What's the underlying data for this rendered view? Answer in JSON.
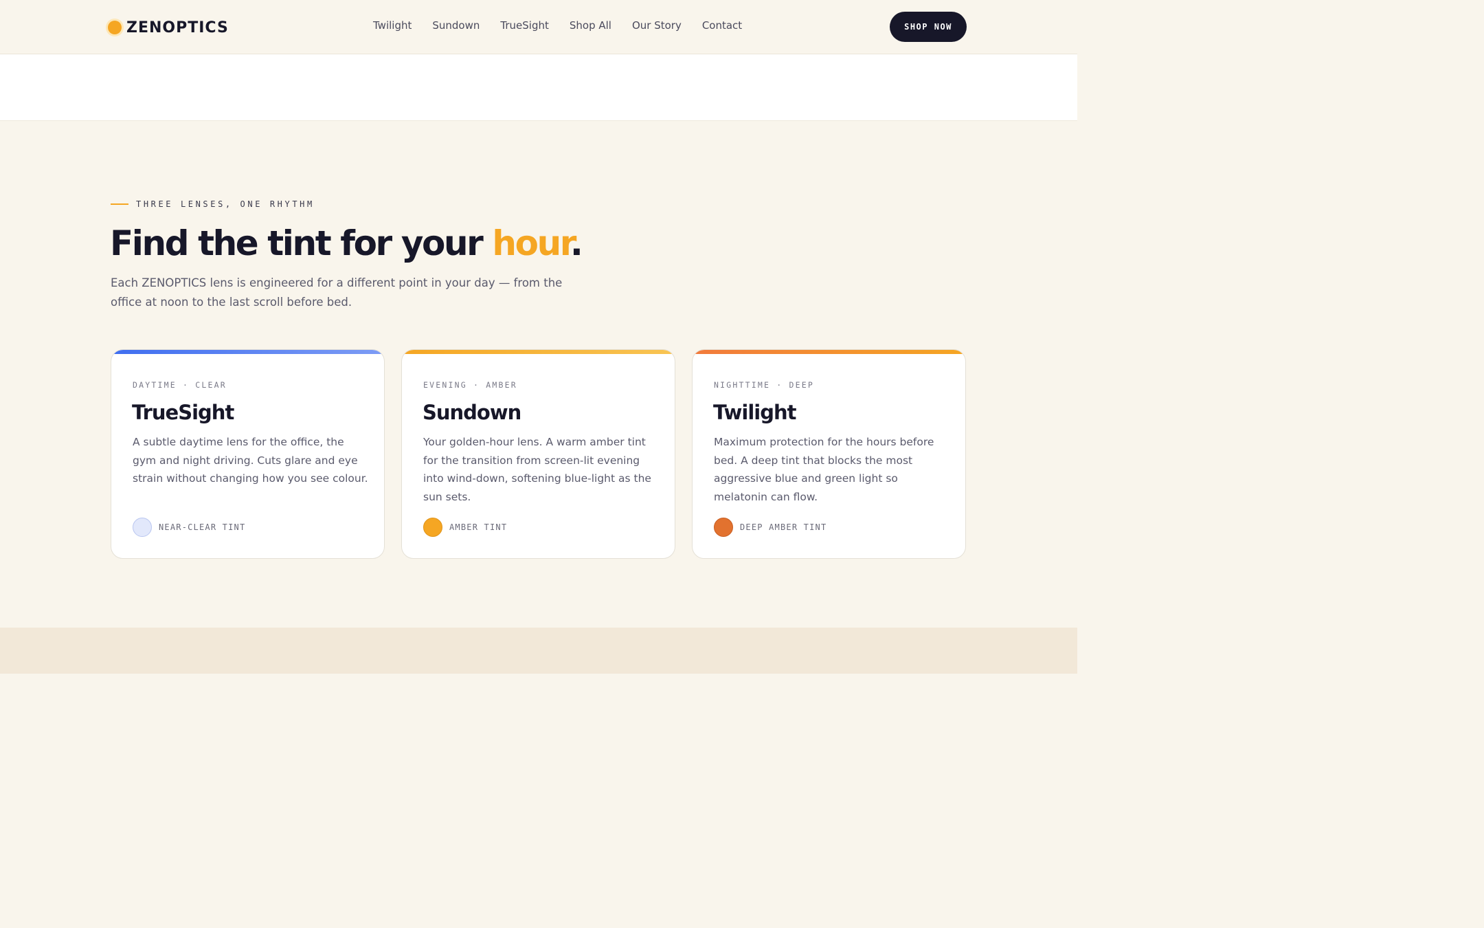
{
  "header": {
    "logo_text": "ZENOPTICS",
    "nav": [
      "Twilight",
      "Sundown",
      "TrueSight",
      "Shop All",
      "Our Story",
      "Contact"
    ],
    "cta_label": "SHOP NOW"
  },
  "section": {
    "eyebrow": "THREE LENSES, ONE RHYTHM",
    "headline_pre": "Find the tint for your ",
    "headline_accent": "hour",
    "headline_post": ".",
    "lede": "Each ZENOPTICS lens is engineered for a different point in your day — from the office at noon to the last scroll before bed."
  },
  "cards": [
    {
      "tag": "DAYTIME · CLEAR",
      "title": "TrueSight",
      "description": "A subtle daytime lens for the office, the gym and night driving. Cuts glare and eye strain without changing how you see colour.",
      "tint_label": "NEAR-CLEAR TINT",
      "bar_gradient": [
        "#3f6ef0",
        "#7d9cf5"
      ],
      "swatch_color": "#e2e8fb"
    },
    {
      "tag": "EVENING · AMBER",
      "title": "Sundown",
      "description": "Your golden-hour lens. A warm amber tint for the transition from screen-lit evening into wind-down, softening blue-light as the sun sets.",
      "tint_label": "AMBER TINT",
      "bar_gradient": [
        "#f5a623",
        "#f8c453"
      ],
      "swatch_color": "#f5a623"
    },
    {
      "tag": "NIGHTTIME · DEEP",
      "title": "Twilight",
      "description": "Maximum protection for the hours before bed. A deep tint that blocks the most aggressive blue and green light so melatonin can flow.",
      "tint_label": "DEEP AMBER TINT",
      "bar_gradient": [
        "#f27a3c",
        "#f5a623"
      ],
      "swatch_color": "#e2722f"
    }
  ],
  "colors": {
    "accent": "#f5a623",
    "ink": "#171729",
    "cream": "#f9f5ec"
  }
}
